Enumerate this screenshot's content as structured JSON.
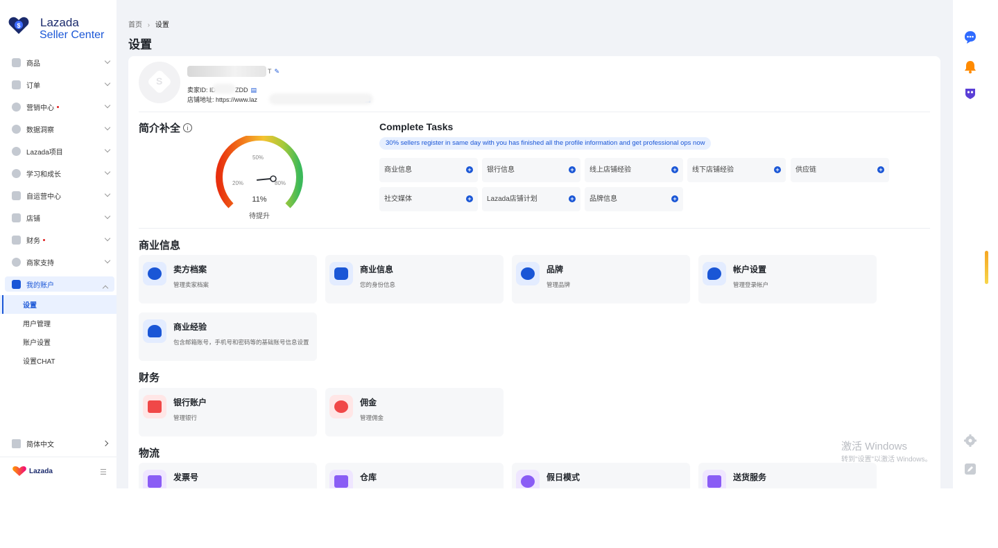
{
  "brand": {
    "line1": "Lazada",
    "line2": "Seller Center",
    "footer_logo": "Lazada"
  },
  "sidebar": {
    "items": [
      {
        "label": "商品",
        "icon": "box-icon",
        "dot": false
      },
      {
        "label": "订单",
        "icon": "order-icon",
        "dot": false
      },
      {
        "label": "营销中心",
        "icon": "marketing-icon",
        "dot": true
      },
      {
        "label": "数据洞察",
        "icon": "data-icon",
        "dot": false
      },
      {
        "label": "Lazada项目",
        "icon": "project-icon",
        "dot": false
      },
      {
        "label": "学习和成长",
        "icon": "learning-icon",
        "dot": false
      },
      {
        "label": "自运营中心",
        "icon": "self-operated-icon",
        "dot": false
      },
      {
        "label": "店铺",
        "icon": "store-icon",
        "dot": false
      },
      {
        "label": "财务",
        "icon": "finance-icon",
        "dot": true
      },
      {
        "label": "商家支持",
        "icon": "support-icon",
        "dot": false
      }
    ],
    "active_parent": {
      "label": "我的账户",
      "icon": "account-icon"
    },
    "sub_items": [
      {
        "label": "设置",
        "active": true
      },
      {
        "label": "用户管理",
        "active": false
      },
      {
        "label": "账户设置",
        "active": false
      },
      {
        "label": "设置CHAT",
        "active": false
      }
    ],
    "language": "简体中文"
  },
  "header": {
    "breadcrumb_home": "首页",
    "breadcrumb_sep": "›",
    "breadcrumb_current": "设置",
    "title": "设置"
  },
  "profile": {
    "name_tail": "T",
    "seller_id_label": "卖家ID: ID",
    "seller_id_tail": "ZDD",
    "store_url_label": "店铺地址: https://www.laz",
    "store_url_tail": "r"
  },
  "gauge": {
    "title": "简介补全",
    "value_percent": 11,
    "value_label": "11%",
    "status": "待提升",
    "tick_labels": [
      "20%",
      "50%",
      "80%"
    ]
  },
  "tasks": {
    "title": "Complete Tasks",
    "banner": "30% sellers register in same day with you has finished all the profile information and get professional ops now",
    "items": [
      "商业信息",
      "银行信息",
      "线上店铺经验",
      "线下店铺经验",
      "供应链",
      "社交媒体",
      "Lazada店铺计划",
      "品牌信息"
    ]
  },
  "sections": {
    "business": {
      "title": "商业信息",
      "tiles": [
        {
          "title": "卖方档案",
          "desc": "管理卖家档案",
          "icon": "seller-profile-icon"
        },
        {
          "title": "商业信息",
          "desc": "您的身份信息",
          "icon": "business-info-icon"
        },
        {
          "title": "品牌",
          "desc": "管理品牌",
          "icon": "brand-icon"
        },
        {
          "title": "帐户设置",
          "desc": "管理登录帐户",
          "icon": "account-settings-icon"
        },
        {
          "title": "商业经验",
          "desc": "包含邮箱账号，手机号和密码等的基础账号信息设置",
          "icon": "business-experience-icon"
        }
      ]
    },
    "finance": {
      "title": "财务",
      "tiles": [
        {
          "title": "银行账户",
          "desc": "管理银行",
          "icon": "bank-card-icon"
        },
        {
          "title": "佣金",
          "desc": "管理佣金",
          "icon": "commission-icon"
        }
      ]
    },
    "logistics": {
      "title": "物流",
      "tiles": [
        {
          "title": "发票号",
          "desc": "",
          "icon": "invoice-icon"
        },
        {
          "title": "仓库",
          "desc": "",
          "icon": "warehouse-icon"
        },
        {
          "title": "假日模式",
          "desc": "",
          "icon": "holiday-mode-icon"
        },
        {
          "title": "送货服务",
          "desc": "",
          "icon": "delivery-service-icon"
        }
      ]
    }
  },
  "watermark": {
    "line1": "激活 Windows",
    "line2": "转到\"设置\"以激活 Windows。"
  },
  "rail": {
    "icons": [
      "chat-icon",
      "bell-icon",
      "assistant-icon",
      "settings-icon",
      "edit-icon"
    ]
  },
  "colors": {
    "primary": "#1a56d6",
    "page_bg": "#f1f3f7",
    "tile_bg": "#f6f7f9",
    "badge_dot": "#e02020"
  }
}
